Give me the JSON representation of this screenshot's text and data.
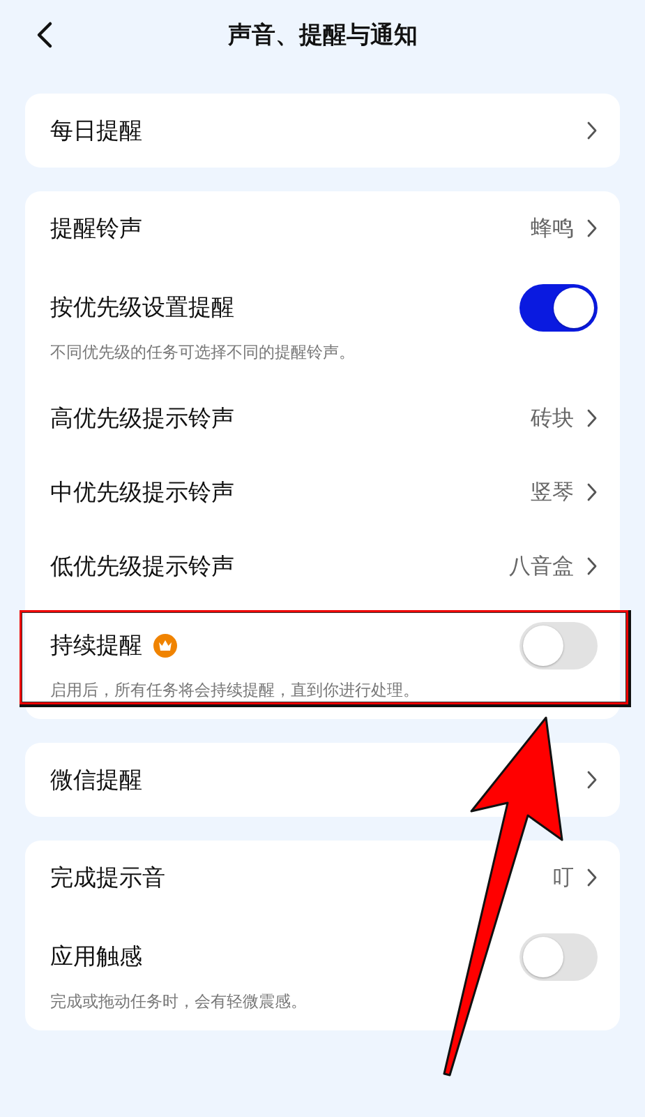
{
  "header": {
    "title": "声音、提醒与通知"
  },
  "groups": [
    {
      "rows": [
        {
          "kind": "link",
          "label": "每日提醒"
        }
      ]
    },
    {
      "rows": [
        {
          "kind": "link",
          "label": "提醒铃声",
          "value": "蜂鸣"
        },
        {
          "kind": "toggle",
          "label": "按优先级设置提醒",
          "description": "不同优先级的任务可选择不同的提醒铃声。",
          "on": true
        },
        {
          "kind": "link",
          "label": "高优先级提示铃声",
          "value": "砖块"
        },
        {
          "kind": "link",
          "label": "中优先级提示铃声",
          "value": "竖琴"
        },
        {
          "kind": "link",
          "label": "低优先级提示铃声",
          "value": "八音盒"
        },
        {
          "kind": "toggle",
          "label": "持续提醒",
          "premium": true,
          "description": "启用后，所有任务将会持续提醒，直到你进行处理。",
          "on": false,
          "highlighted": true
        }
      ]
    },
    {
      "rows": [
        {
          "kind": "link",
          "label": "微信提醒"
        }
      ]
    },
    {
      "rows": [
        {
          "kind": "link",
          "label": "完成提示音",
          "value": "叮"
        },
        {
          "kind": "toggle",
          "label": "应用触感",
          "description": "完成或拖动任务时，会有轻微震感。",
          "on": false
        }
      ]
    }
  ],
  "annotation": {
    "arrow": true
  }
}
